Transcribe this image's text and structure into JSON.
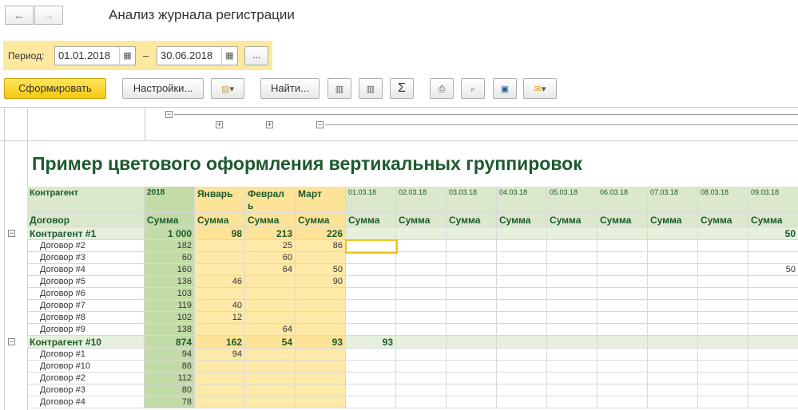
{
  "window": {
    "title": "Анализ журнала регистрации",
    "back_icon": "←",
    "forward_icon": "→"
  },
  "period": {
    "label": "Период:",
    "from": "01.01.2018",
    "to": "30.06.2018",
    "separator": "–",
    "more_label": "..."
  },
  "toolbar": {
    "generate_label": "Сформировать",
    "settings_label": "Настройки...",
    "find_label": "Найти...",
    "sum_label": "Σ"
  },
  "report": {
    "title": "Пример цветового оформления вертикальных группировок",
    "header": {
      "row_dim": "Контрагент",
      "sub_dim": "Договор",
      "year": "2018",
      "months": [
        "Январь",
        "Феврал ь",
        "Март"
      ],
      "days": [
        "01.03.18",
        "02.03.18",
        "03.03.18",
        "04.03.18",
        "05.03.18",
        "06.03.18",
        "07.03.18",
        "08.03.18",
        "09.03.18"
      ],
      "measure": "Сумма"
    },
    "rows": [
      {
        "name": "Контрагент #1",
        "group": true,
        "year": "1 000",
        "m": [
          "98",
          "213",
          "226"
        ],
        "d": [
          "",
          "",
          "",
          "",
          "",
          "",
          "",
          "",
          "50"
        ]
      },
      {
        "name": "Договор #2",
        "group": false,
        "year": "182",
        "m": [
          "",
          "25",
          "86"
        ],
        "d": [
          "",
          "",
          "",
          "",
          "",
          "",
          "",
          "",
          ""
        ]
      },
      {
        "name": "Договор #3",
        "group": false,
        "year": "60",
        "m": [
          "",
          "60",
          ""
        ],
        "d": [
          "",
          "",
          "",
          "",
          "",
          "",
          "",
          "",
          ""
        ]
      },
      {
        "name": "Договор #4",
        "group": false,
        "year": "160",
        "m": [
          "",
          "64",
          "50"
        ],
        "d": [
          "",
          "",
          "",
          "",
          "",
          "",
          "",
          "",
          "50"
        ]
      },
      {
        "name": "Договор #5",
        "group": false,
        "year": "136",
        "m": [
          "46",
          "",
          "90"
        ],
        "d": [
          "",
          "",
          "",
          "",
          "",
          "",
          "",
          "",
          ""
        ]
      },
      {
        "name": "Договор #6",
        "group": false,
        "year": "103",
        "m": [
          "",
          "",
          ""
        ],
        "d": [
          "",
          "",
          "",
          "",
          "",
          "",
          "",
          "",
          ""
        ]
      },
      {
        "name": "Договор #7",
        "group": false,
        "year": "119",
        "m": [
          "40",
          "",
          ""
        ],
        "d": [
          "",
          "",
          "",
          "",
          "",
          "",
          "",
          "",
          ""
        ]
      },
      {
        "name": "Договор #8",
        "group": false,
        "year": "102",
        "m": [
          "12",
          "",
          ""
        ],
        "d": [
          "",
          "",
          "",
          "",
          "",
          "",
          "",
          "",
          ""
        ]
      },
      {
        "name": "Договор #9",
        "group": false,
        "year": "138",
        "m": [
          "",
          "64",
          ""
        ],
        "d": [
          "",
          "",
          "",
          "",
          "",
          "",
          "",
          "",
          ""
        ]
      },
      {
        "name": "Контрагент #10",
        "group": true,
        "year": "874",
        "m": [
          "162",
          "54",
          "93"
        ],
        "d": [
          "93",
          "",
          "",
          "",
          "",
          "",
          "",
          "",
          ""
        ]
      },
      {
        "name": "Договор #1",
        "group": false,
        "year": "94",
        "m": [
          "94",
          "",
          ""
        ],
        "d": [
          "",
          "",
          "",
          "",
          "",
          "",
          "",
          "",
          ""
        ]
      },
      {
        "name": "Договор #10",
        "group": false,
        "year": "86",
        "m": [
          "",
          "",
          ""
        ],
        "d": [
          "",
          "",
          "",
          "",
          "",
          "",
          "",
          "",
          ""
        ]
      },
      {
        "name": "Договор #2",
        "group": false,
        "year": "112",
        "m": [
          "",
          "",
          ""
        ],
        "d": [
          "",
          "",
          "",
          "",
          "",
          "",
          "",
          "",
          ""
        ]
      },
      {
        "name": "Договор #3",
        "group": false,
        "year": "80",
        "m": [
          "",
          "",
          ""
        ],
        "d": [
          "",
          "",
          "",
          "",
          "",
          "",
          "",
          "",
          ""
        ]
      },
      {
        "name": "Договор #4",
        "group": false,
        "year": "78",
        "m": [
          "",
          "",
          ""
        ],
        "d": [
          "",
          "",
          "",
          "",
          "",
          "",
          "",
          "",
          ""
        ]
      }
    ]
  }
}
